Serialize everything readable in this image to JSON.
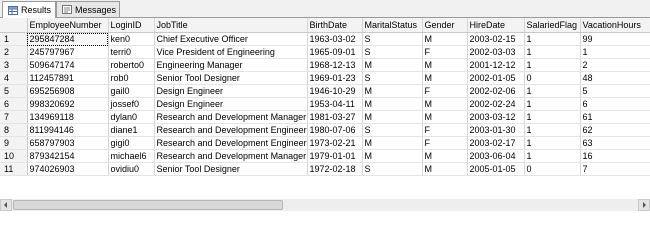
{
  "tabs": [
    {
      "label": "Results",
      "icon": "grid-results-icon",
      "active": true
    },
    {
      "label": "Messages",
      "icon": "messages-icon",
      "active": false
    }
  ],
  "columns": [
    "EmployeeNumber",
    "LoginID",
    "JobTitle",
    "BirthDate",
    "MaritalStatus",
    "Gender",
    "HireDate",
    "SalariedFlag",
    "VacationHours"
  ],
  "rows": [
    {
      "n": "1",
      "cells": [
        "295847284",
        "ken0",
        "Chief Executive Officer",
        "1963-03-02",
        "S",
        "M",
        "2003-02-15",
        "1",
        "99"
      ]
    },
    {
      "n": "2",
      "cells": [
        "245797967",
        "terri0",
        "Vice President of Engineering",
        "1965-09-01",
        "S",
        "F",
        "2002-03-03",
        "1",
        "1"
      ]
    },
    {
      "n": "3",
      "cells": [
        "509647174",
        "roberto0",
        "Engineering Manager",
        "1968-12-13",
        "M",
        "M",
        "2001-12-12",
        "1",
        "2"
      ]
    },
    {
      "n": "4",
      "cells": [
        "112457891",
        "rob0",
        "Senior Tool Designer",
        "1969-01-23",
        "S",
        "M",
        "2002-01-05",
        "0",
        "48"
      ]
    },
    {
      "n": "5",
      "cells": [
        "695256908",
        "gail0",
        "Design Engineer",
        "1946-10-29",
        "M",
        "F",
        "2002-02-06",
        "1",
        "5"
      ]
    },
    {
      "n": "6",
      "cells": [
        "998320692",
        "jossef0",
        "Design Engineer",
        "1953-04-11",
        "M",
        "M",
        "2002-02-24",
        "1",
        "6"
      ]
    },
    {
      "n": "7",
      "cells": [
        "134969118",
        "dylan0",
        "Research and Development Manager",
        "1981-03-27",
        "M",
        "M",
        "2003-03-12",
        "1",
        "61"
      ]
    },
    {
      "n": "8",
      "cells": [
        "811994146",
        "diane1",
        "Research and Development Engineer",
        "1980-07-06",
        "S",
        "F",
        "2003-01-30",
        "1",
        "62"
      ]
    },
    {
      "n": "9",
      "cells": [
        "658797903",
        "gigi0",
        "Research and Development Engineer",
        "1973-02-21",
        "M",
        "F",
        "2003-02-17",
        "1",
        "63"
      ]
    },
    {
      "n": "10",
      "cells": [
        "879342154",
        "michael6",
        "Research and Development Manager",
        "1979-01-01",
        "M",
        "M",
        "2003-06-04",
        "1",
        "16"
      ]
    },
    {
      "n": "11",
      "cells": [
        "974026903",
        "ovidiu0",
        "Senior Tool Designer",
        "1972-02-18",
        "S",
        "M",
        "2005-01-05",
        "0",
        "7"
      ]
    }
  ],
  "colors": {
    "header_bg": "#f3f3f3",
    "grid_line": "#d6d6d6",
    "tab_border": "#9a9a9a"
  }
}
